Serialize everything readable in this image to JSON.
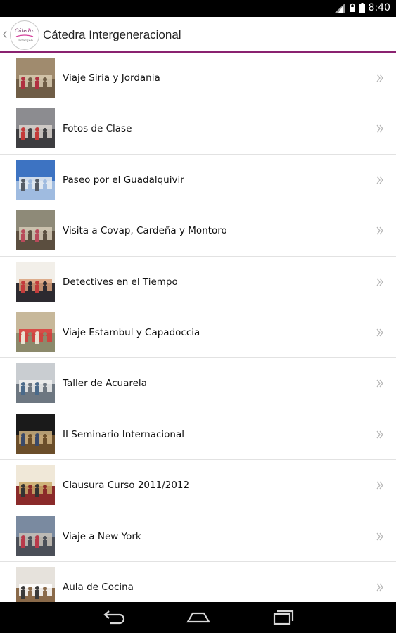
{
  "status_bar": {
    "time": "8:40",
    "icons": [
      "signal-icon",
      "lock-icon",
      "battery-icon"
    ]
  },
  "action_bar": {
    "title": "Cátedra Intergeneracional",
    "logo_icon": "catedra-logo"
  },
  "albums": [
    {
      "label": "Viaje Siria y Jordania",
      "thumb": "group-at-monument-photo",
      "palette": [
        "#a08b6e",
        "#6f5d46",
        "#d9cbb2",
        "#b03040"
      ]
    },
    {
      "label": "Fotos de Clase",
      "thumb": "class-group-photo",
      "palette": [
        "#8c8c90",
        "#3d3d40",
        "#d9d4cf",
        "#c33a3a"
      ]
    },
    {
      "label": "Paseo por el Guadalquivir",
      "thumb": "bridge-pylons-photo",
      "palette": [
        "#3d73c2",
        "#9fbbe0",
        "#eaeef2",
        "#555c66"
      ]
    },
    {
      "label": "Visita a Covap, Cardeña y Montoro",
      "thumb": "group-outdoors-photo",
      "palette": [
        "#8e8a78",
        "#5b4e3f",
        "#d6cbb7",
        "#b84a5a"
      ]
    },
    {
      "label": "Detectives en el Tiempo",
      "thumb": "people-standing-photo",
      "palette": [
        "#f2efe9",
        "#2c2a30",
        "#d9a07a",
        "#c23b3b"
      ]
    },
    {
      "label": "Viaje Estambul y Capadoccia",
      "thumb": "balloon-landscape-photo",
      "palette": [
        "#c7b89a",
        "#8c8a6c",
        "#d93a3a",
        "#e9e2d2"
      ]
    },
    {
      "label": "Taller de Acuarela",
      "thumb": "workshop-room-photo",
      "palette": [
        "#c9cdd1",
        "#6d7781",
        "#f0f0f0",
        "#4a6a8a"
      ]
    },
    {
      "label": "II Seminario Internacional",
      "thumb": "seminar-stage-photo",
      "palette": [
        "#1a1a1a",
        "#6b4e2a",
        "#d0b483",
        "#3a4a6a"
      ]
    },
    {
      "label": "Clausura Curso 2011/2012",
      "thumb": "ceremony-photo",
      "palette": [
        "#f0e8d8",
        "#8a2a2a",
        "#c9a96a",
        "#333333"
      ]
    },
    {
      "label": "Viaje a New York",
      "thumb": "city-group-photo",
      "palette": [
        "#7a8aa0",
        "#4b4f58",
        "#c9c2b8",
        "#b83a4a"
      ]
    },
    {
      "label": "Aula de Cocina",
      "thumb": "kitchen-class-photo",
      "palette": [
        "#e6e2dc",
        "#8a6a4a",
        "#ffffff",
        "#3a3a3a"
      ]
    }
  ],
  "nav_bar": {
    "buttons": [
      "back-icon",
      "home-icon",
      "recent-apps-icon"
    ]
  }
}
